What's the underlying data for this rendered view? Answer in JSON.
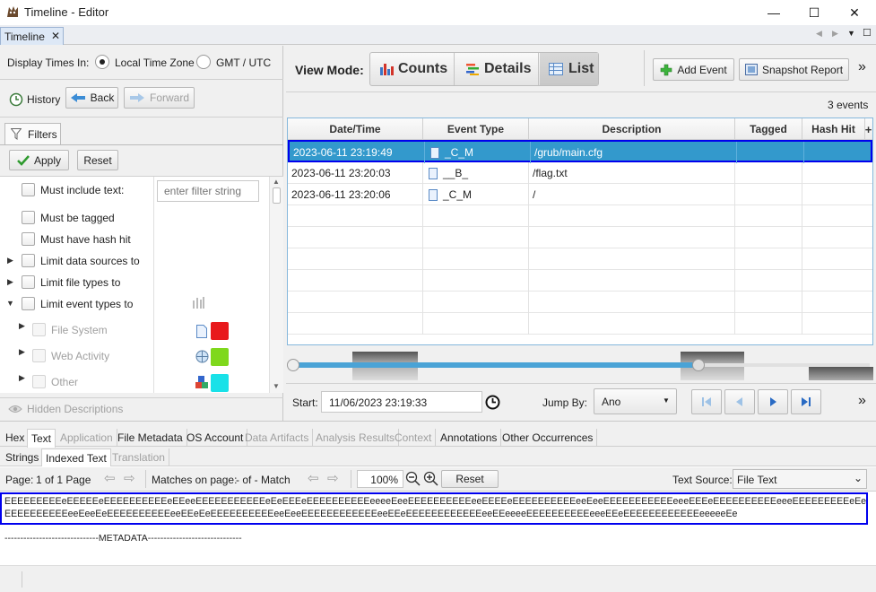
{
  "window": {
    "title": "Timeline - Editor",
    "minimize": "—",
    "maximize": "☐",
    "close": "✕"
  },
  "tab": {
    "label": "Timeline",
    "close": "✕"
  },
  "tabstrip_nav": {
    "back": "◀",
    "forward": "▶",
    "menu": "▼",
    "restore": "☐"
  },
  "display_times": {
    "label": "Display Times In:",
    "option_local": "Local Time Zone",
    "option_gmt": "GMT / UTC",
    "selected": "Local Time Zone"
  },
  "history": {
    "label": "History",
    "back": "Back",
    "forward": "Forward"
  },
  "filters": {
    "tab_label": "Filters",
    "apply": "Apply",
    "reset": "Reset",
    "text_placeholder": "enter filter string",
    "items": [
      {
        "label": "Must include text:"
      },
      {
        "label": "Must be tagged"
      },
      {
        "label": "Must have hash hit"
      },
      {
        "label": "Limit data sources to"
      },
      {
        "label": "Limit file types to"
      },
      {
        "label": "Limit event types to"
      },
      {
        "label": "File System",
        "color": "#e8191c"
      },
      {
        "label": "Web Activity",
        "color": "#7fd81c"
      },
      {
        "label": "Other",
        "color": "#19e1e8"
      }
    ]
  },
  "descriptions": {
    "label": "Hidden Descriptions"
  },
  "view_mode": {
    "label": "View Mode:",
    "counts": "Counts",
    "details": "Details",
    "list": "List",
    "selected": "List"
  },
  "toolbar": {
    "add_event": "Add Event",
    "snapshot": "Snapshot Report",
    "more": "»"
  },
  "events_count": "3 events",
  "table": {
    "columns": [
      "Date/Time",
      "Event Type",
      "Description",
      "Tagged",
      "Hash Hit"
    ],
    "add_column": "+",
    "rows": [
      {
        "datetime": "2023-06-11 23:19:49",
        "type": "_C_M",
        "description": "/grub/main.cfg",
        "tagged": "",
        "hash": "",
        "selected": true
      },
      {
        "datetime": "2023-06-11 23:20:03",
        "type": "__B_",
        "description": "/flag.txt",
        "tagged": "",
        "hash": "",
        "selected": false
      },
      {
        "datetime": "2023-06-11 23:20:06",
        "type": "_C_M",
        "description": "/",
        "tagged": "",
        "hash": "",
        "selected": false
      }
    ]
  },
  "range": {
    "start_label": "Start:",
    "start_value": "11/06/2023 23:19:33",
    "jump_label": "Jump By:",
    "jump_value": "Ano",
    "more": "»"
  },
  "content_tabs": [
    "Hex",
    "Text",
    "Application",
    "File Metadata",
    "OS Account",
    "Data Artifacts",
    "Analysis Results",
    "Context",
    "Annotations",
    "Other Occurrences"
  ],
  "content_tab_selected": "Text",
  "text_subtabs": [
    "Strings",
    "Indexed Text",
    "Translation"
  ],
  "text_subtab_selected": "Indexed Text",
  "textbar": {
    "page_label": "Page:",
    "page_value": "1 of 1 Page",
    "matches_label": "Matches on page:",
    "matches_value": "- of - Match",
    "zoom": "100%",
    "reset": "Reset",
    "source_label": "Text Source:",
    "source_value": "File Text"
  },
  "text_content": {
    "line1": "EEEEEEEEEeEEEEEeEEEEEEEEEEeEEeeEEEEEEEEEEEeEeEEEeEEEEEEEEEEeeeeEeeEEEEEEEEEEeeEEEEeEEEEEEEEEEeeEeeEEEEEEEEEEEeeeEEEeEEEEEEEEEEeeeEEEEEEEEEeEeeeeeEEEEEEEEEEEeeEEeEEEEEEEEEEEeEeeeee",
    "line2": "EEEEEEEEEEeeEeeEeEEEEEEEEEEeeEEeEeEEEEEEEEEEeeEeeEEEEEEEEEEEEeeEEeEEEEEEEEEEEEeeEEeeeeEEEEEEEEEEeeeEEeEEEEEEEEEEEEeeeeeEe",
    "metadata": "------------------------------METADATA------------------------------"
  },
  "colors": {
    "selection": "#3399cc",
    "focus_border": "#0000ee",
    "accent": "#4aa3d6"
  }
}
